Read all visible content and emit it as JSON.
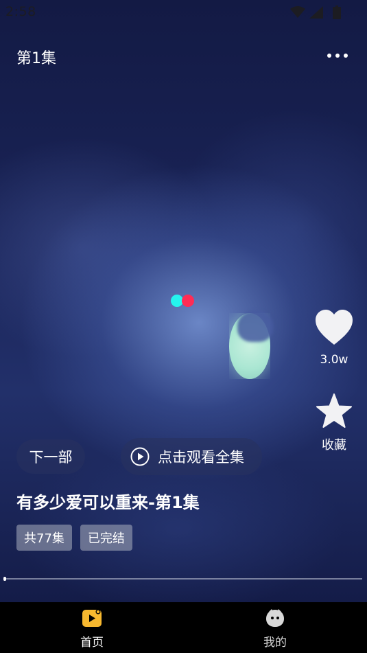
{
  "status_bar": {
    "time": "2:58",
    "icons": [
      "wifi-icon",
      "signal-icon",
      "battery-icon"
    ]
  },
  "top_bar": {
    "episode_title": "第1集",
    "more_icon": "more-horizontal-icon"
  },
  "player": {
    "loading_indicator": "two-dot-loader",
    "colors": {
      "dot_left": "#25f4ee",
      "dot_right": "#fe2c55"
    },
    "progress_fraction": 0.0
  },
  "side_actions": {
    "like_icon": "heart-icon",
    "like_count": "3.0w",
    "favorite_icon": "star-icon",
    "favorite_label": "收藏"
  },
  "actions": {
    "next_series_label": "下一部",
    "watch_all_label": "点击观看全集",
    "watch_all_icon": "play-circle-icon"
  },
  "drama": {
    "title": "有多少爱可以重来-第1集",
    "tags": [
      "共77集",
      "已完结"
    ]
  },
  "bottom_nav": {
    "items": [
      {
        "label": "首页",
        "icon": "video-home-icon",
        "active": true,
        "accent": "#f7b82f"
      },
      {
        "label": "我的",
        "icon": "profile-face-icon",
        "active": false
      }
    ]
  }
}
